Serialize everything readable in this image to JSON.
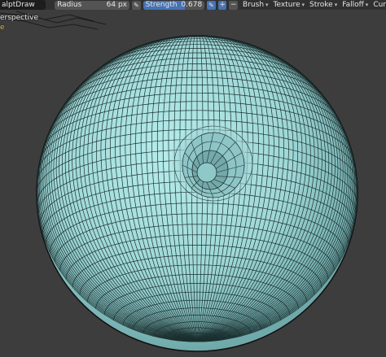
{
  "header": {
    "tool_name": "alptDraw",
    "radius_label": "Radius",
    "radius_value": "64 px",
    "strength_label": "Strength",
    "strength_value": "0.678",
    "strength_fraction": 0.678,
    "menus": [
      {
        "label": "Brush"
      },
      {
        "label": "Texture"
      },
      {
        "label": "Stroke"
      },
      {
        "label": "Falloff"
      },
      {
        "label": "Cur"
      }
    ]
  },
  "viewport": {
    "view_name": "erspective",
    "mode_fragment": "e"
  },
  "colors": {
    "background": "#3d3d3d",
    "mesh_fill": "#9fd9d9",
    "wire": "#1a2a2a",
    "accent": "#4772b3"
  }
}
